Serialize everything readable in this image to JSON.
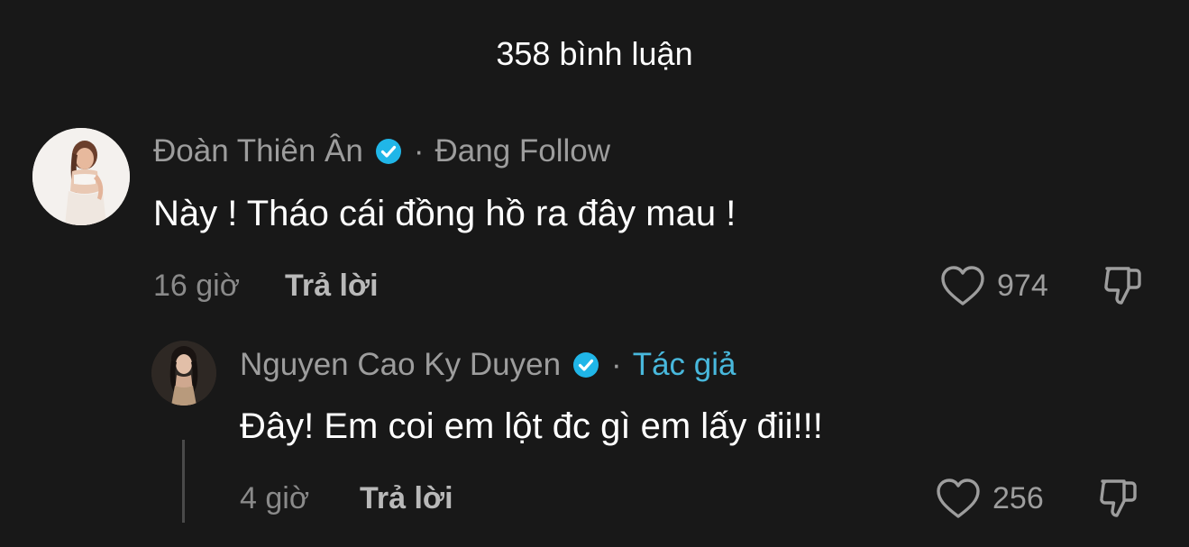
{
  "header": {
    "title": "358 bình luận"
  },
  "comments": [
    {
      "author": "Đoàn Thiên Ân",
      "verified": true,
      "relation": "Đang Follow",
      "text": "Này ! Tháo cái đồng hồ ra đây mau !",
      "time": "16 giờ",
      "reply_label": "Trả lời",
      "likes": "974",
      "avatar_icon": "profile-photo"
    },
    {
      "author": "Nguyen Cao Ky Duyen",
      "verified": true,
      "relation": "Tác giả",
      "text": "Đây! Em coi em lột đc gì em lấy đii!!!",
      "time": "4 giờ",
      "reply_label": "Trả lời",
      "likes": "256",
      "avatar_icon": "profile-photo"
    }
  ],
  "colors": {
    "background": "#181818",
    "text_primary": "#ffffff",
    "text_secondary": "#9d9d9d",
    "author_tag": "#48b8dc",
    "verified_badge": "#20b6e8"
  },
  "icons": {
    "verified": "verified-badge-icon",
    "like": "heart-outline-icon",
    "dislike": "thumbs-down-icon"
  }
}
